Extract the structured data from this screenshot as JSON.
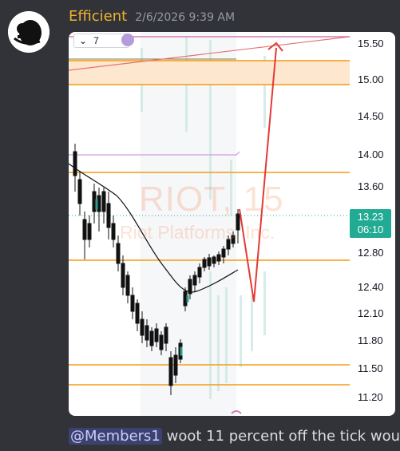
{
  "author": {
    "name": "Efficient",
    "timestamp": "2/6/2026 9:39 AM",
    "avatar": "avatar-image"
  },
  "chart": {
    "interval_select": "7",
    "watermark_symbol": "RIOT, 15",
    "watermark_name": "Riot Platforms, Inc.",
    "current_price": "13.23",
    "countdown": "06:10",
    "y_ticks": [
      "15.50",
      "15.00",
      "14.50",
      "14.00",
      "13.60",
      "12.80",
      "12.40",
      "12.10",
      "11.80",
      "11.50",
      "11.20"
    ]
  },
  "chart_data": {
    "type": "line",
    "title": "RIOT, 15",
    "y_ticks": [
      15.5,
      15.0,
      14.5,
      14.0,
      13.6,
      12.8,
      12.4,
      12.1,
      11.8,
      11.5,
      11.2
    ],
    "current_price": 13.23
  },
  "colors": {
    "accent_orange": "#f39c12",
    "price_green": "#22ab94",
    "arrow_red": "#e53935",
    "username": "#f0b132"
  },
  "message": {
    "mention": "@Members1",
    "text": " woot 11 percent off the tick wou"
  }
}
